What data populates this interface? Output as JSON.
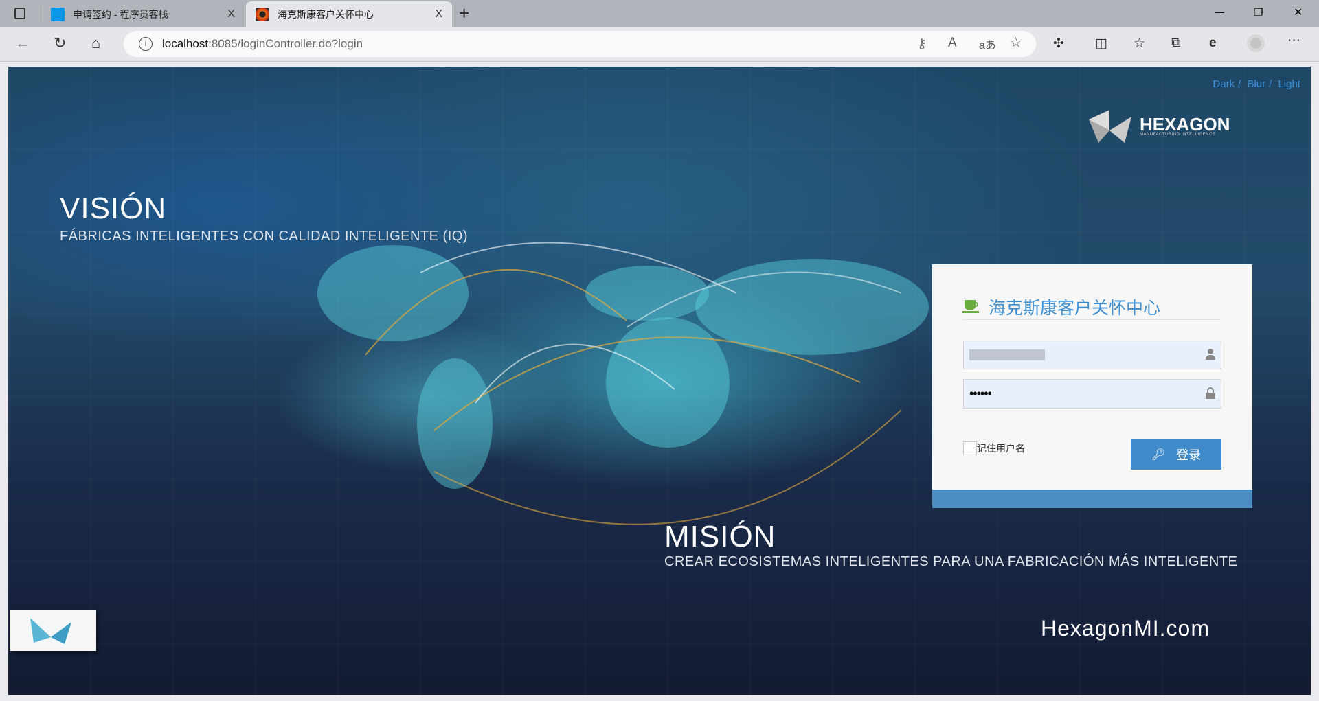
{
  "browser": {
    "tabs": [
      {
        "title": "申请签约 - 程序员客栈",
        "close": "X"
      },
      {
        "title": "海克斯康客户关怀中心",
        "close": "X",
        "active": true
      }
    ],
    "new_tab": "+",
    "url_host": "localhost",
    "url_rest": ":8085/loginController.do?login",
    "window_controls": [
      "—",
      "❐",
      "✕"
    ]
  },
  "page": {
    "theme_links": [
      "Dark",
      "Blur",
      "Light"
    ],
    "separator": "/",
    "logo_text": "HEXAGON",
    "logo_sub": "MANUFACTURING INTELLIGENCE",
    "vision_title": "VISIÓN",
    "vision_text": "FÁBRICAS INTELIGENTES CON CALIDAD INTELIGENTE (IQ)",
    "mision_title": "MISIÓN",
    "mision_text": "CREAR ECOSISTEMAS INTELIGENTES PARA UNA FABRICACIÓN MÁS INTELIGENTE",
    "site": "HexagonMI.com"
  },
  "login": {
    "title": "海克斯康客户关怀中心",
    "username": "",
    "password": "••••••",
    "remember_label": "记住用户名",
    "remember_checked": false,
    "submit_label": "登录",
    "accent": "#428bca"
  }
}
